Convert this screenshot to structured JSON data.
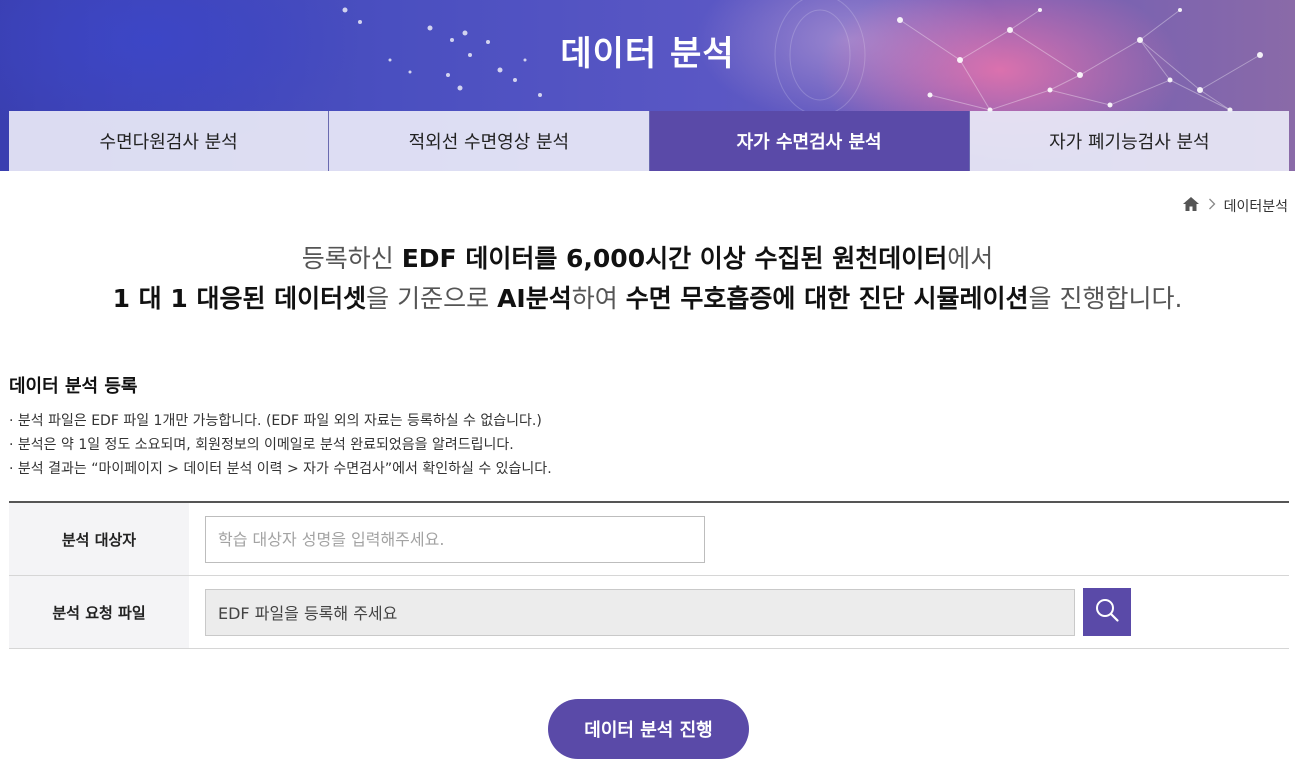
{
  "hero": {
    "title": "데이터 분석"
  },
  "tabs": [
    {
      "label": "수면다원검사 분석",
      "active": false
    },
    {
      "label": "적외선 수면영상 분석",
      "active": false
    },
    {
      "label": "자가 수면검사 분석",
      "active": true
    },
    {
      "label": "자가 폐기능검사 분석",
      "active": false
    }
  ],
  "breadcrumb": {
    "home_icon": "home-icon",
    "current": "데이터분석"
  },
  "intro": {
    "line1": [
      {
        "text": "등록하신 ",
        "strong": false
      },
      {
        "text": "EDF 데이터를 6,000시간 이상 수집된 원천데이터",
        "strong": true
      },
      {
        "text": "에서",
        "strong": false
      }
    ],
    "line2": [
      {
        "text": "1 대 1 대응된 데이터셋",
        "strong": true
      },
      {
        "text": "을 기준으로 ",
        "strong": false
      },
      {
        "text": "AI분석",
        "strong": true
      },
      {
        "text": "하여 ",
        "strong": false
      },
      {
        "text": "수면 무호흡증에 대한 진단 시뮬레이션",
        "strong": true
      },
      {
        "text": "을 진행합니다.",
        "strong": false
      }
    ]
  },
  "register": {
    "title": "데이터 분석 등록",
    "notes": [
      "· 분석 파일은 EDF 파일 1개만 가능합니다. (EDF 파일 외의 자료는 등록하실 수 없습니다.)",
      "· 분석은 약 1일 정도 소요되며, 회원정보의 이메일로 분석 완료되었음을 알려드립니다.",
      "· 분석 결과는 “마이페이지 > 데이터 분석 이력 > 자가 수면검사”에서 확인하실 수 있습니다."
    ]
  },
  "form": {
    "subject_label": "분석 대상자",
    "subject_placeholder": "학습 대상자 성명을 입력해주세요.",
    "subject_value": "",
    "file_label": "분석 요청 파일",
    "file_placeholder": "EDF 파일을 등록해 주세요",
    "file_search_icon": "search-icon"
  },
  "submit": {
    "label": "데이터 분석 진행"
  },
  "colors": {
    "accent": "#5a4aa8",
    "tab_inactive": "#e8e8f6",
    "label_bg": "#f4f4f6",
    "file_bg": "#ececec"
  }
}
